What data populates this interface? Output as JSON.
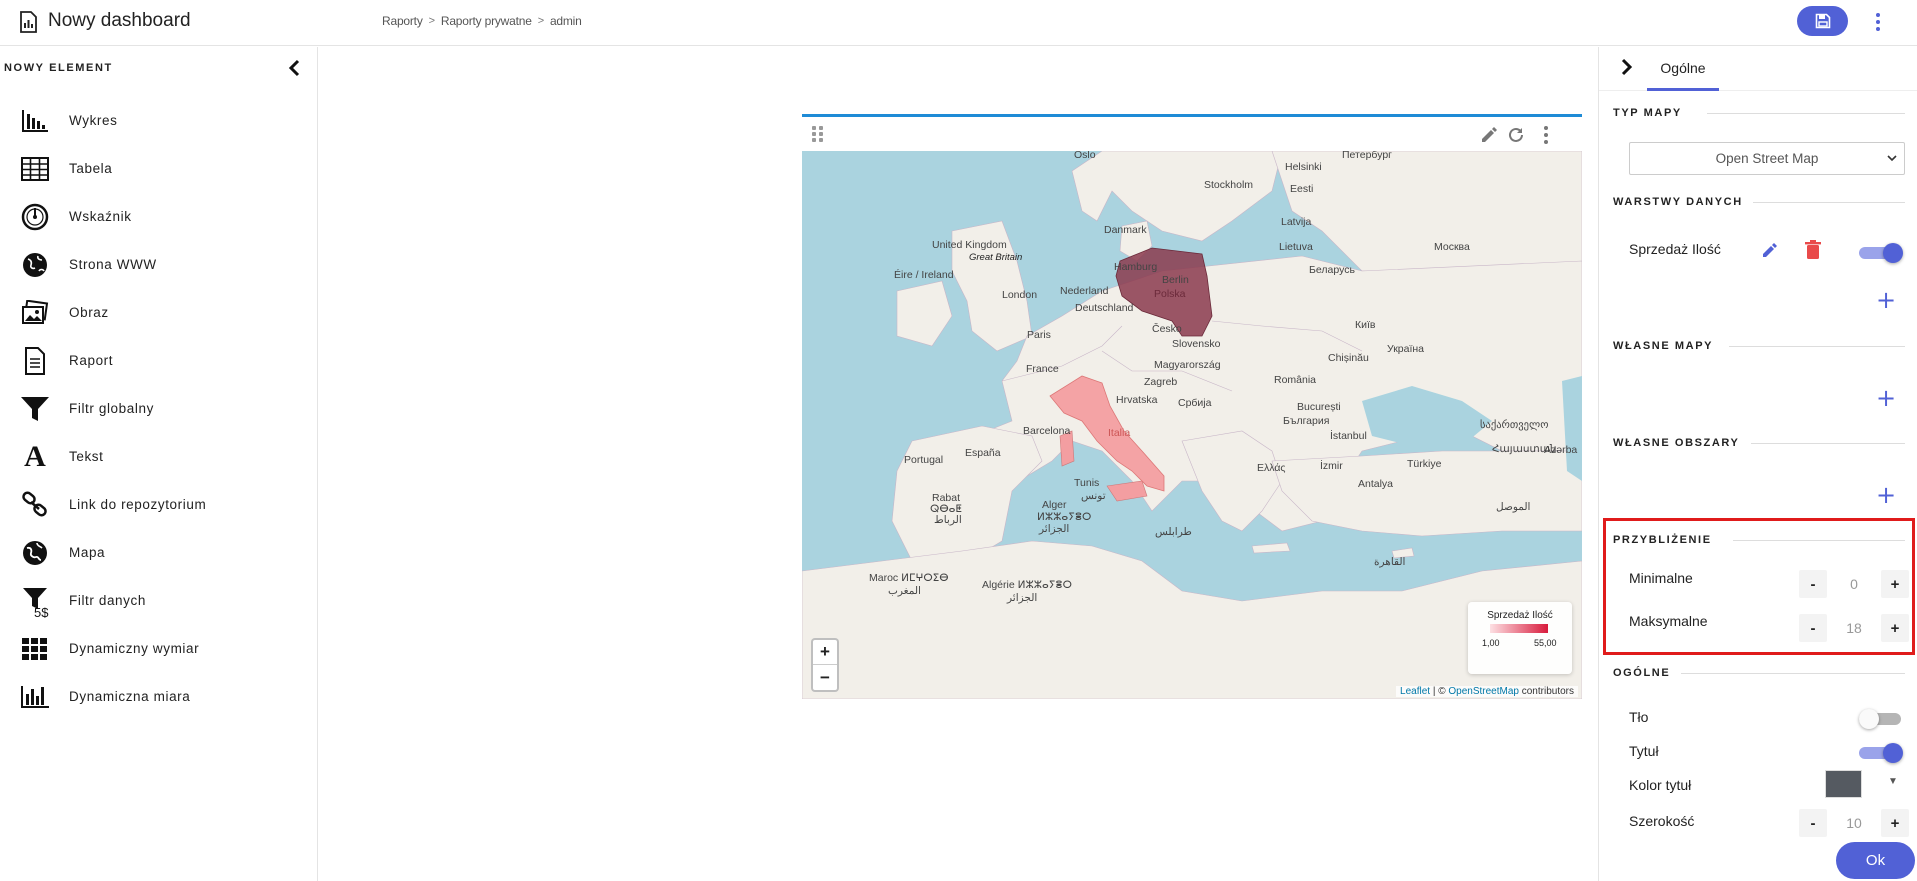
{
  "header": {
    "title": "Nowy dashboard",
    "breadcrumb": [
      "Raporty",
      "Raporty prywatne",
      "admin"
    ],
    "breadcrumb_sep": ">"
  },
  "left_panel": {
    "section_title": "NOWY ELEMENT",
    "items": [
      {
        "label": "Wykres",
        "icon": "bar-chart-icon"
      },
      {
        "label": "Tabela",
        "icon": "table-icon"
      },
      {
        "label": "Wskaźnik",
        "icon": "gauge-icon"
      },
      {
        "label": "Strona WWW",
        "icon": "globe-icon"
      },
      {
        "label": "Obraz",
        "icon": "image-icon"
      },
      {
        "label": "Raport",
        "icon": "document-icon"
      },
      {
        "label": "Filtr globalny",
        "icon": "filter-icon"
      },
      {
        "label": "Tekst",
        "icon": "text-icon"
      },
      {
        "label": "Link do repozytorium",
        "icon": "link-icon"
      },
      {
        "label": "Mapa",
        "icon": "earth-icon"
      },
      {
        "label": "Filtr danych",
        "icon": "data-filter-icon"
      },
      {
        "label": "Dynamiczny wymiar",
        "icon": "grid-icon"
      },
      {
        "label": "Dynamiczna miara",
        "icon": "measure-chart-icon"
      }
    ],
    "data_filter_badge": "5$",
    "text_icon_glyph": "A"
  },
  "map": {
    "labels": [
      {
        "text": "Oslo"
      },
      {
        "text": "Helsinki"
      },
      {
        "text": "Петербург"
      },
      {
        "text": "Stockholm"
      },
      {
        "text": "Eesti"
      },
      {
        "text": "Danmark"
      },
      {
        "text": "Latvija"
      },
      {
        "text": "United Kingdom"
      },
      {
        "text": "Great Britain"
      },
      {
        "text": "Lietuva"
      },
      {
        "text": "Москва"
      },
      {
        "text": "Hamburg"
      },
      {
        "text": "Éire / Ireland"
      },
      {
        "text": "Berlin"
      },
      {
        "text": "Беларусь"
      },
      {
        "text": "London"
      },
      {
        "text": "Nederland"
      },
      {
        "text": "Polska"
      },
      {
        "text": "Deutschland"
      },
      {
        "text": "Česko"
      },
      {
        "text": "Київ"
      },
      {
        "text": "Paris"
      },
      {
        "text": "Slovensko"
      },
      {
        "text": "Magyarország"
      },
      {
        "text": "Україна"
      },
      {
        "text": "France"
      },
      {
        "text": "Chișinău"
      },
      {
        "text": "Zagreb"
      },
      {
        "text": "România"
      },
      {
        "text": "Hrvatska"
      },
      {
        "text": "Србија"
      },
      {
        "text": "București"
      },
      {
        "text": "България"
      },
      {
        "text": "Barcelona"
      },
      {
        "text": "Italia"
      },
      {
        "text": "İstanbul"
      },
      {
        "text": "საქართველო"
      },
      {
        "text": "Portugal"
      },
      {
        "text": "España"
      },
      {
        "text": "Հայաստան"
      },
      {
        "text": "Ελλάς"
      },
      {
        "text": "İzmir"
      },
      {
        "text": "Türkiye"
      },
      {
        "text": "Azərba"
      },
      {
        "text": "Antalya"
      },
      {
        "text": "Tunis"
      },
      {
        "text": "تونس"
      },
      {
        "text": "Rabat"
      },
      {
        "text": "Alger"
      },
      {
        "text": "ⵍⵣⵣⴰⵢⴻⵔ"
      },
      {
        "text": "الرباط"
      },
      {
        "text": "الجزائر"
      },
      {
        "text": "ⵕⴱⴰⵟ"
      },
      {
        "text": "طرابلس"
      },
      {
        "text": "الموصل"
      },
      {
        "text": "القاهرة"
      },
      {
        "text": "Maroc ⵍⵎⵖⵔⵉⴱ"
      },
      {
        "text": "المغرب"
      },
      {
        "text": "Algérie ⵍⵣⵣⴰⵢⴻⵔ"
      },
      {
        "text": "الجزائر"
      }
    ],
    "zoom_in": "+",
    "zoom_out": "−",
    "legend": {
      "title": "Sprzedaż Ilość",
      "min": "1,00",
      "max": "55,00",
      "color_low": "#fde0e3",
      "color_high": "#d81b3c"
    },
    "attribution": {
      "leaflet": "Leaflet",
      "sep": " | © ",
      "osm": "OpenStreetMap",
      "suffix": " contributors"
    },
    "region_colors": {
      "poland": "#8b3a4e",
      "italy": "#f39ea1"
    }
  },
  "right_panel": {
    "tab": "Ogólne",
    "map_type": {
      "title": "TYP MAPY",
      "value": "Open Street Map"
    },
    "data_layers": {
      "title": "WARSTWY DANYCH",
      "layer_name": "Sprzedaż Ilość",
      "enabled": true
    },
    "custom_maps": {
      "title": "WŁASNE MAPY"
    },
    "custom_areas": {
      "title": "WŁASNE OBSZARY"
    },
    "zoom": {
      "title": "PRZYBLIŻENIE",
      "min_label": "Minimalne",
      "min_value": "0",
      "max_label": "Maksymalne",
      "max_value": "18"
    },
    "general": {
      "title": "OGÓLNE",
      "background_label": "Tło",
      "background_on": false,
      "title_label": "Tytuł",
      "title_on": true,
      "title_color_label": "Kolor tytuł",
      "title_color": "#555a61",
      "width_label": "Szerokość",
      "width_value": "10"
    },
    "stepper_minus": "-",
    "stepper_plus": "+",
    "add": "+",
    "ok_label": "Ok",
    "accent": "#5161d6",
    "highlight_color": "#e01b1b"
  }
}
